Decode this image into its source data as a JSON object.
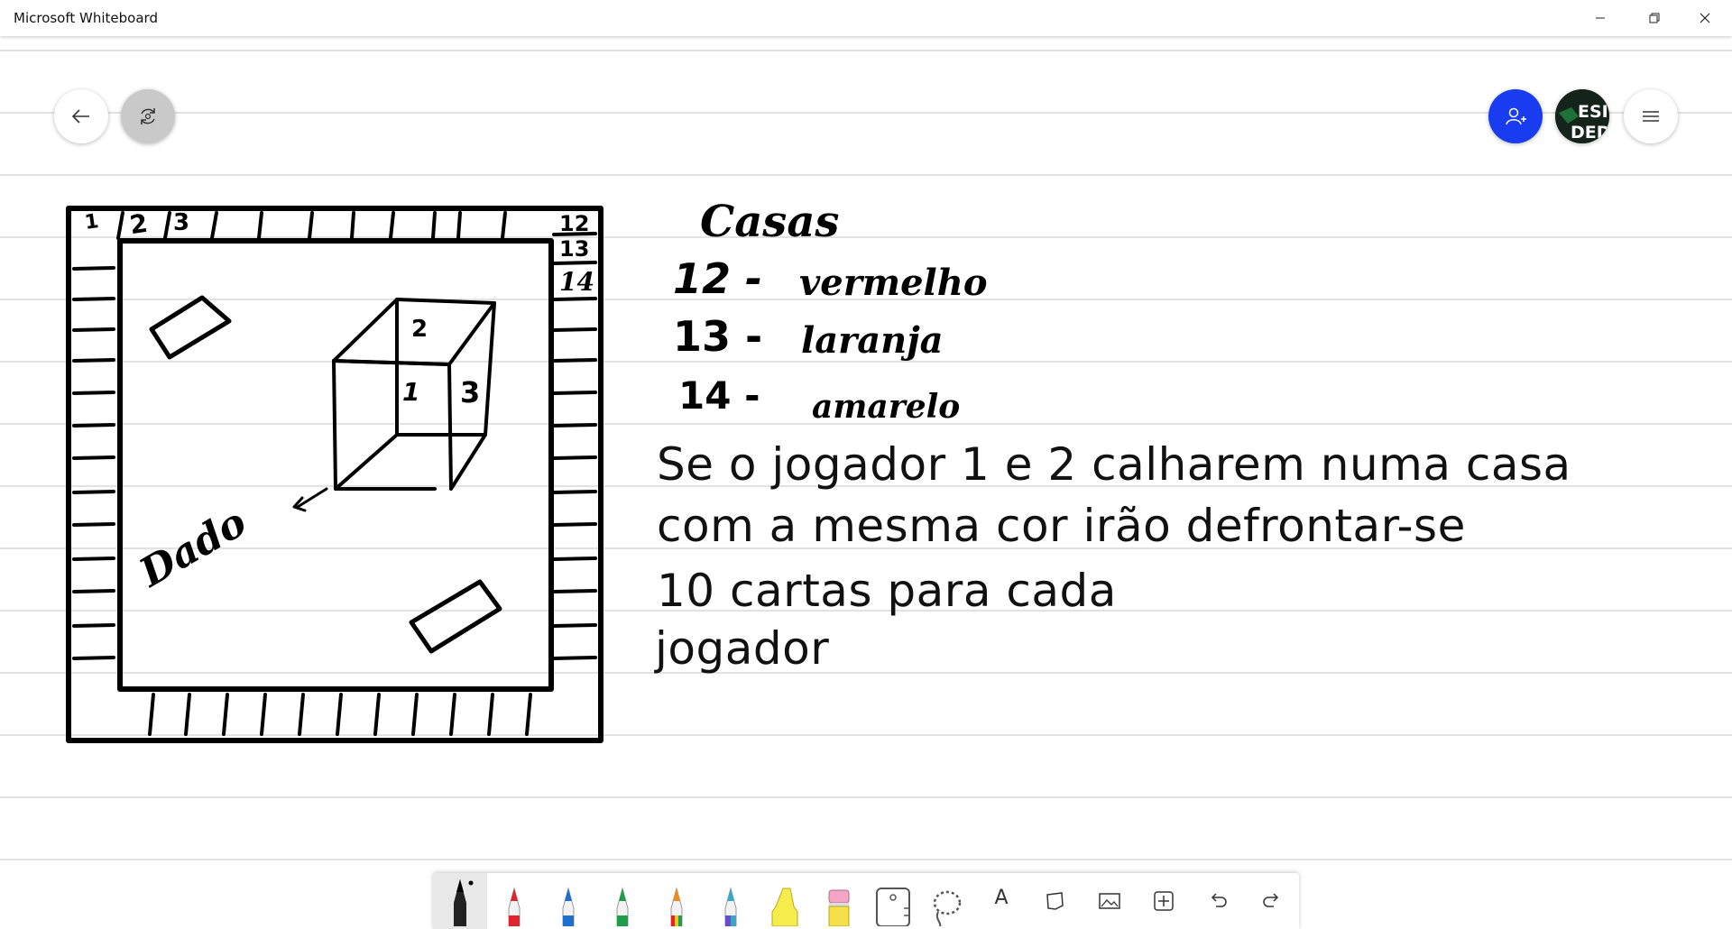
{
  "window": {
    "title": "Microsoft Whiteboard",
    "controls": [
      "minimize",
      "restore",
      "close"
    ]
  },
  "top_controls": {
    "back_icon": "arrow-left-icon",
    "sync_icon": "sync-icon",
    "invite_icon": "person-add-icon",
    "avatar_text": "ESI\nDED",
    "menu_icon": "hamburger-menu-icon",
    "invite_color": "#1a3cf0"
  },
  "board": {
    "cells_top": [
      "1",
      "2",
      "3"
    ],
    "cells_right": [
      "12",
      "13",
      "14"
    ],
    "cube_labels": [
      "2",
      "1",
      "3"
    ],
    "dice_label": "Dado",
    "houses_title": "Casas",
    "houses": [
      {
        "num": "12 -",
        "color": "vermelho"
      },
      {
        "num": "13 -",
        "color": "laranja"
      },
      {
        "num": "14 -",
        "color": "amarelo"
      }
    ],
    "typed_lines": [
      "Se o jogador 1 e 2 calharem numa casa",
      "com a mesma cor irão defrontar-se",
      "10 cartas para cada",
      "jogador"
    ]
  },
  "toolbar": {
    "tools": [
      {
        "name": "pen-black",
        "color": "#111111",
        "active": true
      },
      {
        "name": "pen-red",
        "color": "#e0242f"
      },
      {
        "name": "pen-blue",
        "color": "#1f6fd0"
      },
      {
        "name": "pen-green",
        "color": "#1e9e4a"
      },
      {
        "name": "pen-rainbow",
        "color": "#f28a1e"
      },
      {
        "name": "pen-galaxy",
        "color": "#3aa7c9"
      },
      {
        "name": "highlighter",
        "color": "#f6ec4b"
      },
      {
        "name": "eraser",
        "color": "#f3a6c6"
      },
      {
        "name": "ruler",
        "color": "#555555"
      },
      {
        "name": "lasso",
        "color": "#555555"
      },
      {
        "name": "text",
        "label": "A"
      },
      {
        "name": "note"
      },
      {
        "name": "image"
      },
      {
        "name": "insert"
      },
      {
        "name": "undo"
      },
      {
        "name": "redo"
      }
    ]
  }
}
